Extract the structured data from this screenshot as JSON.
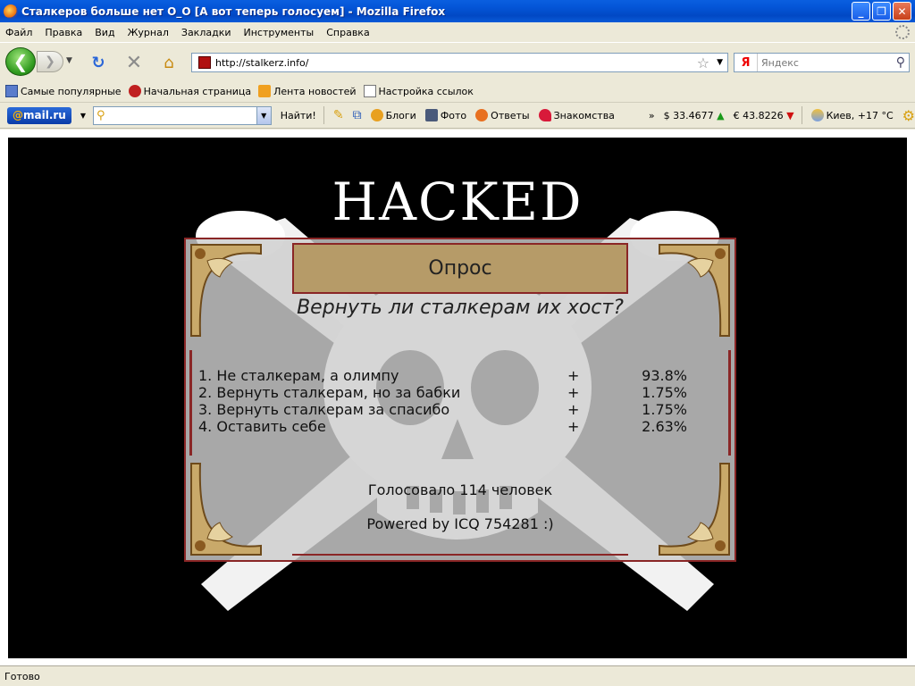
{
  "window": {
    "title": "Сталкеров больше нет O_O [А вот теперь голосуем] - Mozilla Firefox"
  },
  "menu": [
    "Файл",
    "Правка",
    "Вид",
    "Журнал",
    "Закладки",
    "Инструменты",
    "Справка"
  ],
  "nav": {
    "url": "http://stalkerz.info/",
    "search_placeholder": "Яндекс",
    "search_engine_logo": "Я"
  },
  "bookmarks": [
    "Самые популярные",
    "Начальная страница",
    "Лента новостей",
    "Настройка ссылок"
  ],
  "mailru": {
    "logo_at": "@",
    "logo_name": "mail",
    "logo_tld": ".ru",
    "find_label": "Найти!",
    "links": [
      "Блоги",
      "Фото",
      "Ответы",
      "Знакомства"
    ],
    "more": "»",
    "usd": "$ 33.4677",
    "eur": "€ 43.8226",
    "weather": "Киев, +17 °С"
  },
  "page": {
    "banner": "HACKED",
    "poll_title": "Опрос",
    "question": "Вернуть ли сталкерам их хост?",
    "options": [
      {
        "text": "1. Не сталкерам, а олимпу",
        "vote": "+",
        "percent": "93.8%"
      },
      {
        "text": "2. Вернуть сталкерам, но за бабки",
        "vote": "+",
        "percent": "1.75%"
      },
      {
        "text": "3. Вернуть сталкерам за спасибо",
        "vote": "+",
        "percent": "1.75%"
      },
      {
        "text": "4. Оставить себе",
        "vote": "+",
        "percent": "2.63%"
      }
    ],
    "voted": "Голосовало 114 человек",
    "powered": "Powered by ICQ 754281 :)"
  },
  "status": "Готово",
  "colors": {
    "title_bar": "#0148c4",
    "poll_border": "#8a2626",
    "poll_header": "#b69b68"
  }
}
